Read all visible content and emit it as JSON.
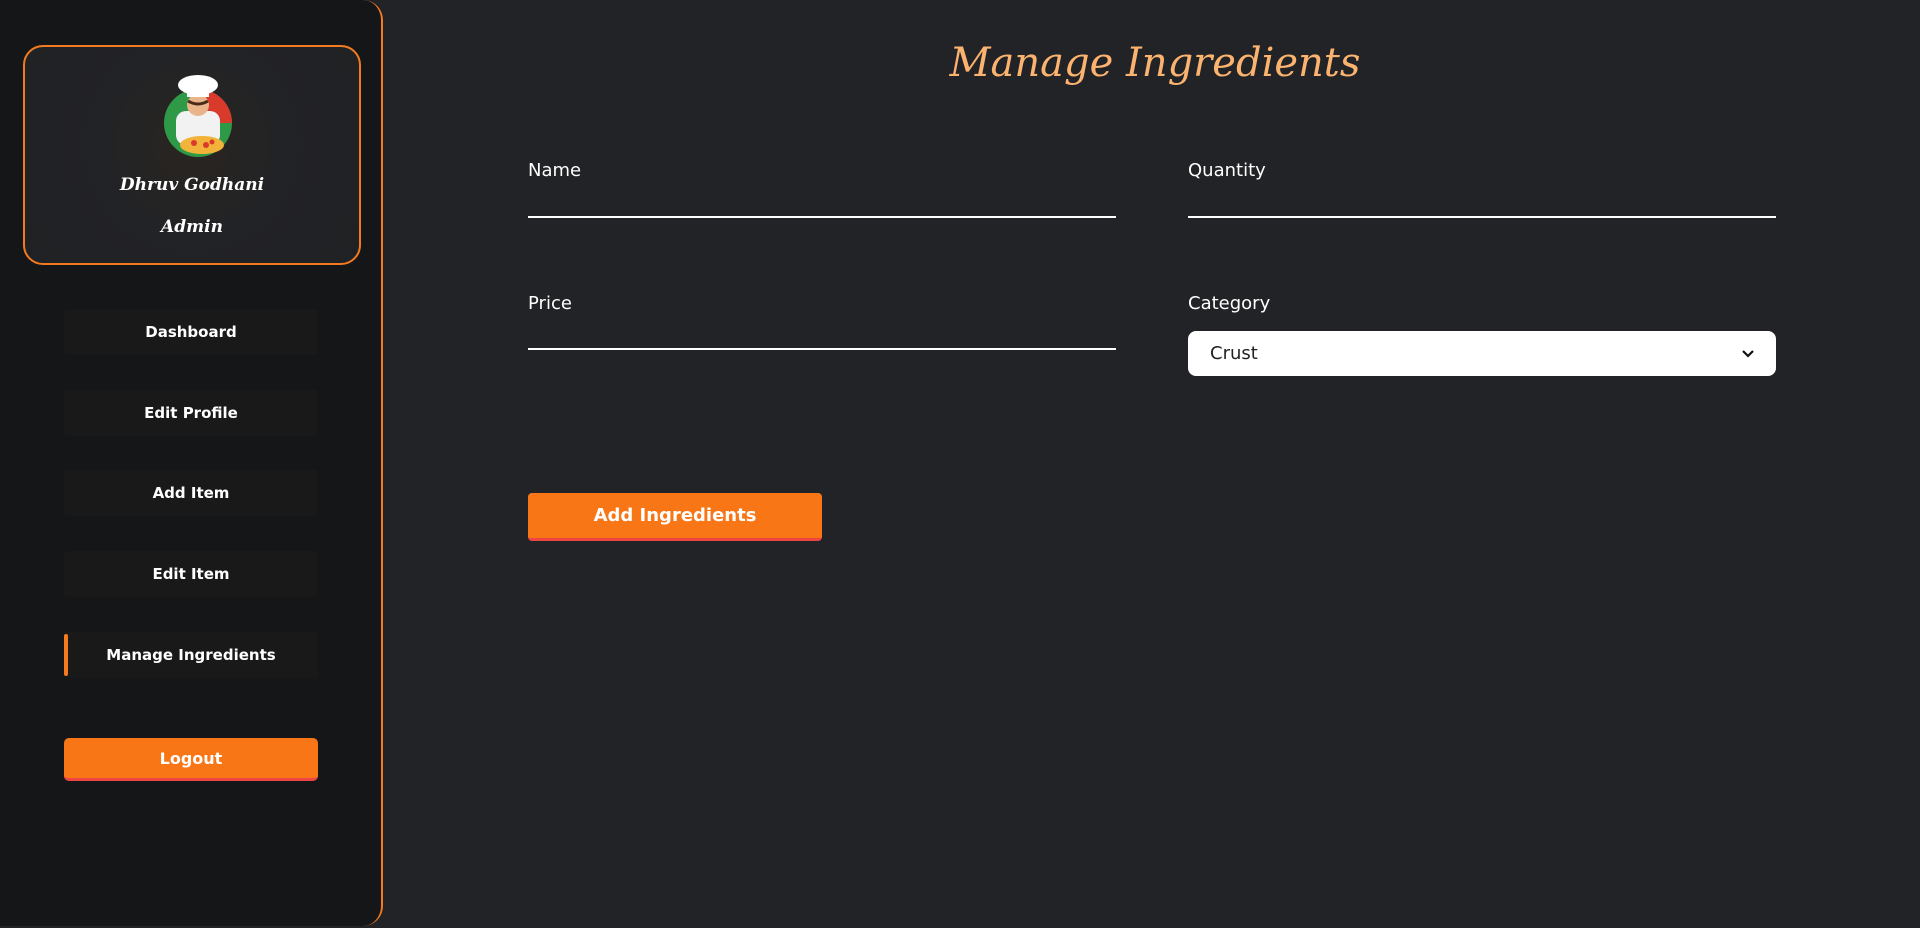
{
  "profile": {
    "name": "Dhruv Godhani",
    "role": "Admin"
  },
  "sidebar": {
    "items": [
      {
        "label": "Dashboard",
        "active": false
      },
      {
        "label": "Edit Profile",
        "active": false
      },
      {
        "label": "Add Item",
        "active": false
      },
      {
        "label": "Edit Item",
        "active": false
      },
      {
        "label": "Manage Ingredients",
        "active": true
      }
    ],
    "logout_label": "Logout"
  },
  "main": {
    "title": "Manage Ingredients",
    "fields": {
      "name": {
        "label": "Name",
        "value": ""
      },
      "quantity": {
        "label": "Quantity",
        "value": ""
      },
      "price": {
        "label": "Price",
        "value": ""
      },
      "category": {
        "label": "Category",
        "selected": "Crust"
      }
    },
    "submit_label": "Add Ingredients"
  },
  "colors": {
    "accent": "#f97616",
    "title": "#fbb36f",
    "background": "#222326",
    "sidebar": "#151618"
  }
}
